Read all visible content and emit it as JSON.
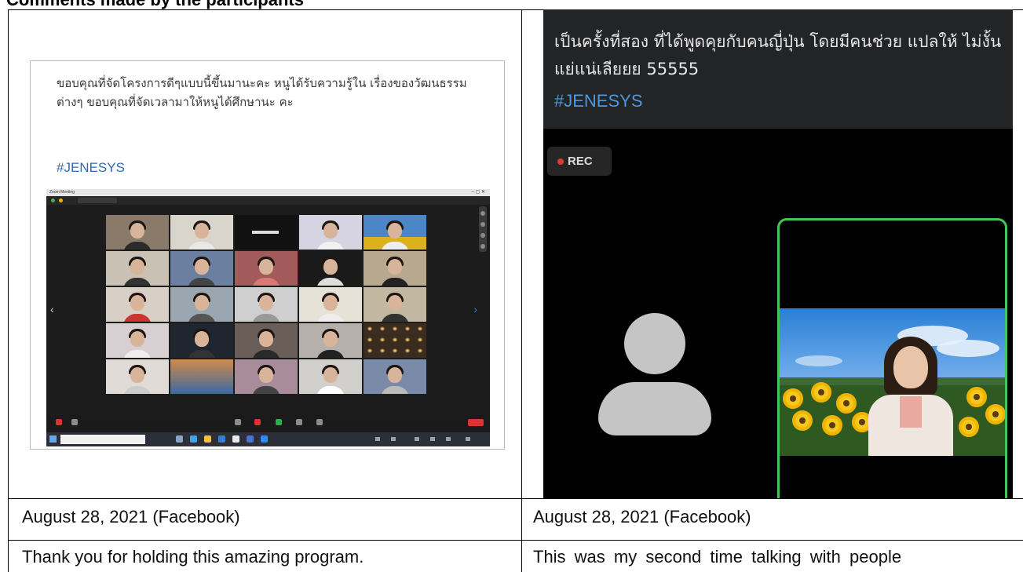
{
  "page": {
    "header_fragment": "Comments made by the participants"
  },
  "left_cell": {
    "post_text": "ขอบคุณที่จัดโครงการดีๆแบบนี้ขึ้นมานะคะ หนูได้รับความรู้ใน เรื่องของวัฒนธรรมต่างๆ ขอบคุณที่จัดเวลามาให้หนูได้ศึกษานะ คะ",
    "hashtag": "#JENESYS",
    "meeting_title": "Zoom Meeting",
    "window_controls": "–  ▢  ✕",
    "date": "August 28, 2021 (Facebook)",
    "comment": "Thank you for holding this amazing program.",
    "arrow_left": "‹",
    "arrow_right": "›"
  },
  "right_cell": {
    "post_text": "เป็นครั้งที่สอง ที่ได้พูดคุยกับคนญี่ปุ่น โดยมีคนช่วย แปลให้ ไม่งั้นแย่แน่เลียยย 55555",
    "hashtag": "#JENESYS",
    "rec_label": "REC",
    "date": "August 28, 2021 (Facebook)",
    "comment": "This was my second time talking with people"
  },
  "colors": {
    "hashtag_blue": "#2d6bb3",
    "rec_red": "#e0392f",
    "speaker_frame_green": "#47c457"
  }
}
